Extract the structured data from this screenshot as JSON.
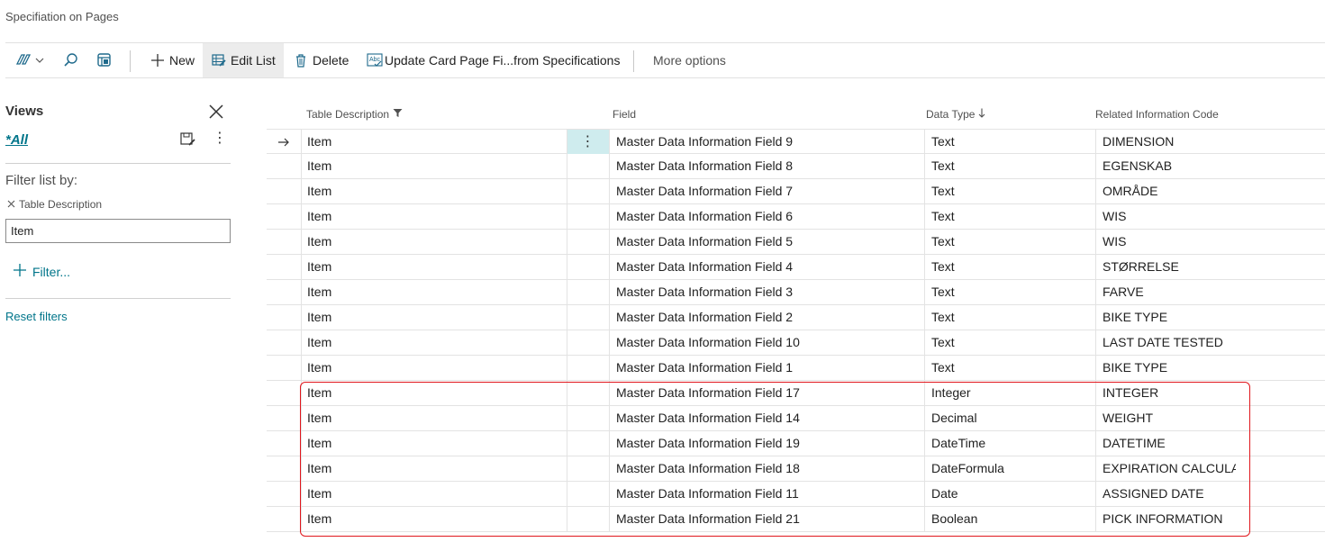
{
  "page": {
    "title": "Specifiation on Pages"
  },
  "toolbar": {
    "new_label": "New",
    "edit_list_label": "Edit List",
    "delete_label": "Delete",
    "update_label": "Update Card Page Fi...from Specifications",
    "more_options_label": "More options"
  },
  "views": {
    "title": "Views",
    "all_label": "*All",
    "filter_list_by_label": "Filter list by:",
    "filter_field_label": "Table Description",
    "filter_value": "Item",
    "add_filter_label": "Filter...",
    "reset_filters_label": "Reset filters"
  },
  "table": {
    "columns": {
      "table_description": "Table Description",
      "field": "Field",
      "data_type": "Data Type",
      "related_information_code": "Related Information Code"
    },
    "rows": [
      {
        "table": "Item",
        "field": "Master Data Information Field 9",
        "type": "Text",
        "code": "DIMENSION",
        "selected": true
      },
      {
        "table": "Item",
        "field": "Master Data Information Field 8",
        "type": "Text",
        "code": "EGENSKAB"
      },
      {
        "table": "Item",
        "field": "Master Data Information Field 7",
        "type": "Text",
        "code": "OMRÅDE"
      },
      {
        "table": "Item",
        "field": "Master Data Information Field 6",
        "type": "Text",
        "code": "WIS"
      },
      {
        "table": "Item",
        "field": "Master Data Information Field 5",
        "type": "Text",
        "code": "WIS"
      },
      {
        "table": "Item",
        "field": "Master Data Information Field 4",
        "type": "Text",
        "code": "STØRRELSE"
      },
      {
        "table": "Item",
        "field": "Master Data Information Field 3",
        "type": "Text",
        "code": "FARVE"
      },
      {
        "table": "Item",
        "field": "Master Data Information Field 2",
        "type": "Text",
        "code": "BIKE TYPE"
      },
      {
        "table": "Item",
        "field": "Master Data Information Field 10",
        "type": "Text",
        "code": "LAST DATE TESTED"
      },
      {
        "table": "Item",
        "field": "Master Data Information Field 1",
        "type": "Text",
        "code": "BIKE TYPE"
      },
      {
        "table": "Item",
        "field": "Master Data Information Field 17",
        "type": "Integer",
        "code": "INTEGER"
      },
      {
        "table": "Item",
        "field": "Master Data Information Field 14",
        "type": "Decimal",
        "code": "WEIGHT"
      },
      {
        "table": "Item",
        "field": "Master Data Information Field 19",
        "type": "DateTime",
        "code": "DATETIME"
      },
      {
        "table": "Item",
        "field": "Master Data Information Field 18",
        "type": "DateFormula",
        "code": "EXPIRATION CALCULATI"
      },
      {
        "table": "Item",
        "field": "Master Data Information Field 11",
        "type": "Date",
        "code": "ASSIGNED DATE"
      },
      {
        "table": "Item",
        "field": "Master Data Information Field 21",
        "type": "Boolean",
        "code": "PICK INFORMATION"
      }
    ]
  },
  "icons": {
    "data_type_sort_icon": "arrow-down-icon",
    "table_description_filter_icon": "funnel-icon",
    "selected_row_icon": "arrow-right-icon",
    "row_menu_icon": "vertical-ellipsis-icon"
  },
  "colors": {
    "accent": "#00758a",
    "highlight_box": "#e0161c",
    "selected_cell": "#cfecee"
  }
}
